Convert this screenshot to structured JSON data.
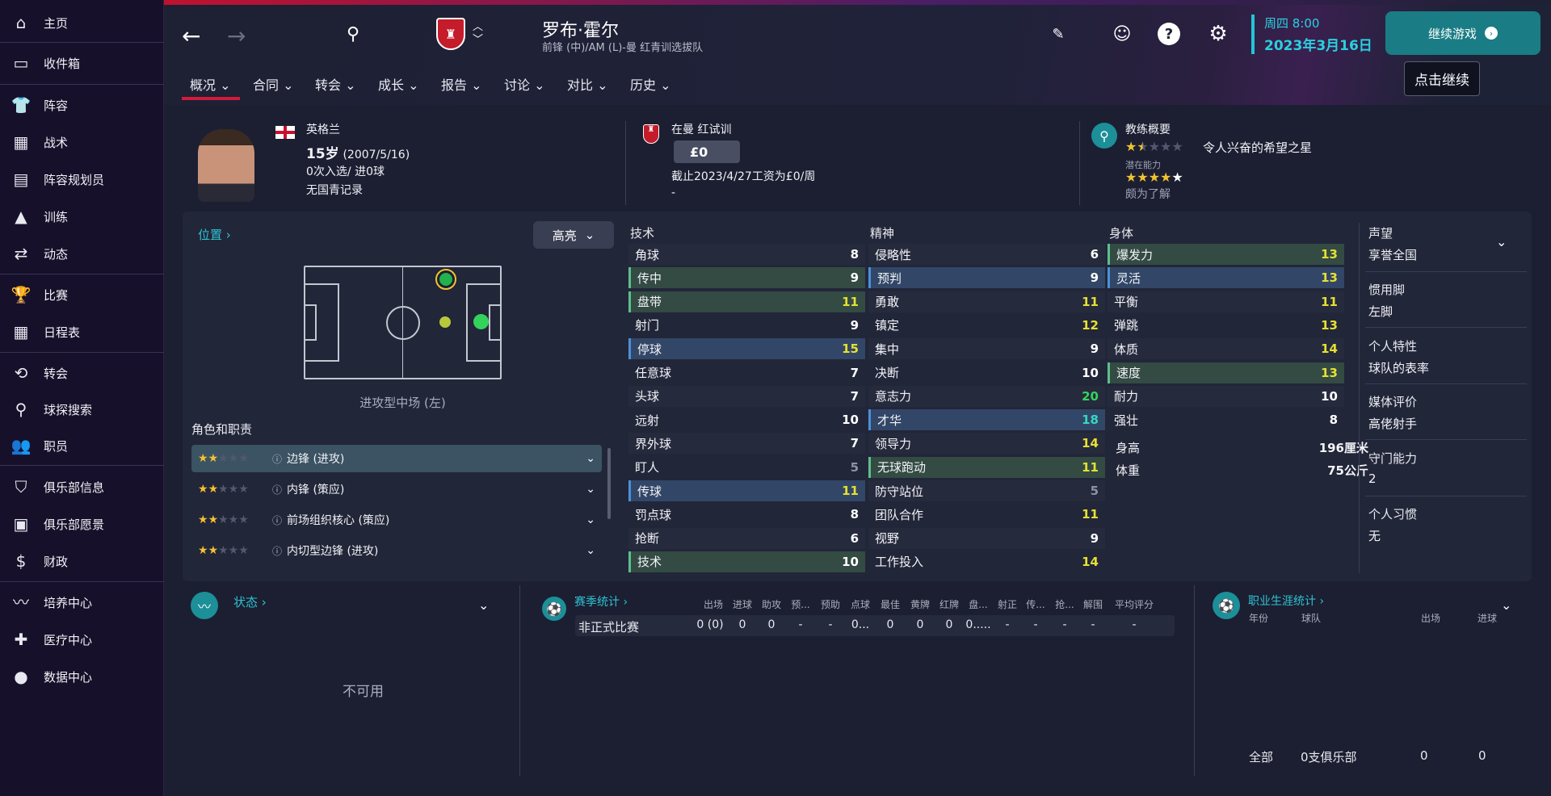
{
  "sidebar": {
    "items": [
      {
        "label": "主页",
        "icon": "home-icon"
      },
      {
        "label": "收件箱",
        "icon": "inbox-icon"
      },
      {
        "label": "阵容",
        "icon": "shirt-icon"
      },
      {
        "label": "战术",
        "icon": "tactics-board-icon"
      },
      {
        "label": "阵容规划员",
        "icon": "clipboard-icon"
      },
      {
        "label": "训练",
        "icon": "training-cone-icon"
      },
      {
        "label": "动态",
        "icon": "dynamics-icon"
      },
      {
        "label": "比赛",
        "icon": "trophy-icon"
      },
      {
        "label": "日程表",
        "icon": "calendar-icon"
      },
      {
        "label": "转会",
        "icon": "transfer-icon"
      },
      {
        "label": "球探搜索",
        "icon": "search-icon"
      },
      {
        "label": "职员",
        "icon": "staff-icon"
      },
      {
        "label": "俱乐部信息",
        "icon": "shield-icon"
      },
      {
        "label": "俱乐部愿景",
        "icon": "briefcase-icon"
      },
      {
        "label": "财政",
        "icon": "money-icon"
      },
      {
        "label": "培养中心",
        "icon": "development-icon"
      },
      {
        "label": "医疗中心",
        "icon": "medical-icon"
      },
      {
        "label": "数据中心",
        "icon": "data-hub-icon"
      }
    ]
  },
  "header": {
    "player_name": "罗布·霍尔",
    "player_sub": "前锋 (中)/AM (L)-曼 红青训选拔队",
    "day": "周四 8:00",
    "date": "2023年3月16日",
    "continue_label": "继续游戏",
    "continue_tip": "点击继续",
    "tabs": [
      "概况",
      "合同",
      "转会",
      "成长",
      "报告",
      "讨论",
      "对比",
      "历史"
    ]
  },
  "overview": {
    "nation": "英格兰",
    "age": "15岁",
    "dob": "(2007/5/16)",
    "caps": "0次入选/ 进0球",
    "youth": "无国青记录",
    "club": "在曼 红试训",
    "wage": "£0",
    "wage_note": "截止2023/4/27工资为£0/周",
    "dash": "-",
    "coach_title": "教练概要",
    "current_stars": 1.5,
    "coach_summary": "令人兴奋的希望之星",
    "potential_label": "潜在能力",
    "potential_stars": 5,
    "knowledge": "颇为了解"
  },
  "position": {
    "link": "位置",
    "highlight": "高亮",
    "label": "进攻型中场 (左)",
    "roles_title": "角色和职责",
    "roles": [
      {
        "label": "边锋 (进攻)",
        "stars": 1.5
      },
      {
        "label": "内锋 (策应)",
        "stars": 1.5
      },
      {
        "label": "前场组织核心 (策应)",
        "stars": 1.5
      },
      {
        "label": "内切型边锋 (进攻)",
        "stars": 1.5
      }
    ]
  },
  "attributes": {
    "technical_title": "技术",
    "mental_title": "精神",
    "physical_title": "身体",
    "technical": [
      {
        "name": "角球",
        "value": "8"
      },
      {
        "name": "传中",
        "value": "9"
      },
      {
        "name": "盘带",
        "value": "11"
      },
      {
        "name": "射门",
        "value": "9"
      },
      {
        "name": "停球",
        "value": "15"
      },
      {
        "name": "任意球",
        "value": "7"
      },
      {
        "name": "头球",
        "value": "7"
      },
      {
        "name": "远射",
        "value": "10"
      },
      {
        "name": "界外球",
        "value": "7"
      },
      {
        "name": "盯人",
        "value": "5"
      },
      {
        "name": "传球",
        "value": "11"
      },
      {
        "name": "罚点球",
        "value": "8"
      },
      {
        "name": "抢断",
        "value": "6"
      },
      {
        "name": "技术",
        "value": "10"
      }
    ],
    "mental": [
      {
        "name": "侵略性",
        "value": "6"
      },
      {
        "name": "预判",
        "value": "9"
      },
      {
        "name": "勇敢",
        "value": "11"
      },
      {
        "name": "镇定",
        "value": "12"
      },
      {
        "name": "集中",
        "value": "9"
      },
      {
        "name": "决断",
        "value": "10"
      },
      {
        "name": "意志力",
        "value": "20"
      },
      {
        "name": "才华",
        "value": "18"
      },
      {
        "name": "领导力",
        "value": "14"
      },
      {
        "name": "无球跑动",
        "value": "11"
      },
      {
        "name": "防守站位",
        "value": "5"
      },
      {
        "name": "团队合作",
        "value": "11"
      },
      {
        "name": "视野",
        "value": "9"
      },
      {
        "name": "工作投入",
        "value": "14"
      }
    ],
    "physical": [
      {
        "name": "爆发力",
        "value": "13"
      },
      {
        "name": "灵活",
        "value": "13"
      },
      {
        "name": "平衡",
        "value": "11"
      },
      {
        "name": "弹跳",
        "value": "13"
      },
      {
        "name": "体质",
        "value": "14"
      },
      {
        "name": "速度",
        "value": "13"
      },
      {
        "name": "耐力",
        "value": "10"
      },
      {
        "name": "强壮",
        "value": "8"
      }
    ],
    "height_label": "身高",
    "height": "196厘米",
    "weight_label": "体重",
    "weight": "75公斤"
  },
  "info": [
    {
      "label": "声望",
      "value": "享誉全国"
    },
    {
      "label": "惯用脚",
      "value": "左脚"
    },
    {
      "label": "个人特性",
      "value": "球队的表率"
    },
    {
      "label": "媒体评价",
      "value": "高佬射手"
    },
    {
      "label": "守门能力",
      "value": "2"
    },
    {
      "label": "个人习惯",
      "value": "无"
    }
  ],
  "status": {
    "title": "状态",
    "unavailable": "不可用"
  },
  "season": {
    "title": "赛季统计",
    "headers": [
      "出场",
      "进球",
      "助攻",
      "预...",
      "预助",
      "点球",
      "最佳",
      "黄牌",
      "红牌",
      "盘...",
      "射正",
      "传...",
      "抢...",
      "解围",
      "平均评分"
    ],
    "row_label": "非正式比赛",
    "row": [
      "0 (0)",
      "0",
      "0",
      "-",
      "-",
      "0...",
      "0",
      "0",
      "0",
      "0.....",
      "-",
      "-",
      "-",
      "-",
      "-"
    ]
  },
  "career": {
    "title": "职业生涯统计",
    "headers": [
      "年份",
      "球队",
      "出场",
      "进球"
    ],
    "total_label": "全部",
    "total_clubs": "0支俱乐部",
    "total_apps": "0",
    "total_goals": "0"
  },
  "colors": {
    "accent_teal": "#1c8f98",
    "accent_red": "#d01b3a",
    "highlight_green": "#334b43",
    "highlight_blue": "#324767",
    "value_yellow": "#e6e032",
    "value_green": "#33d35b"
  }
}
